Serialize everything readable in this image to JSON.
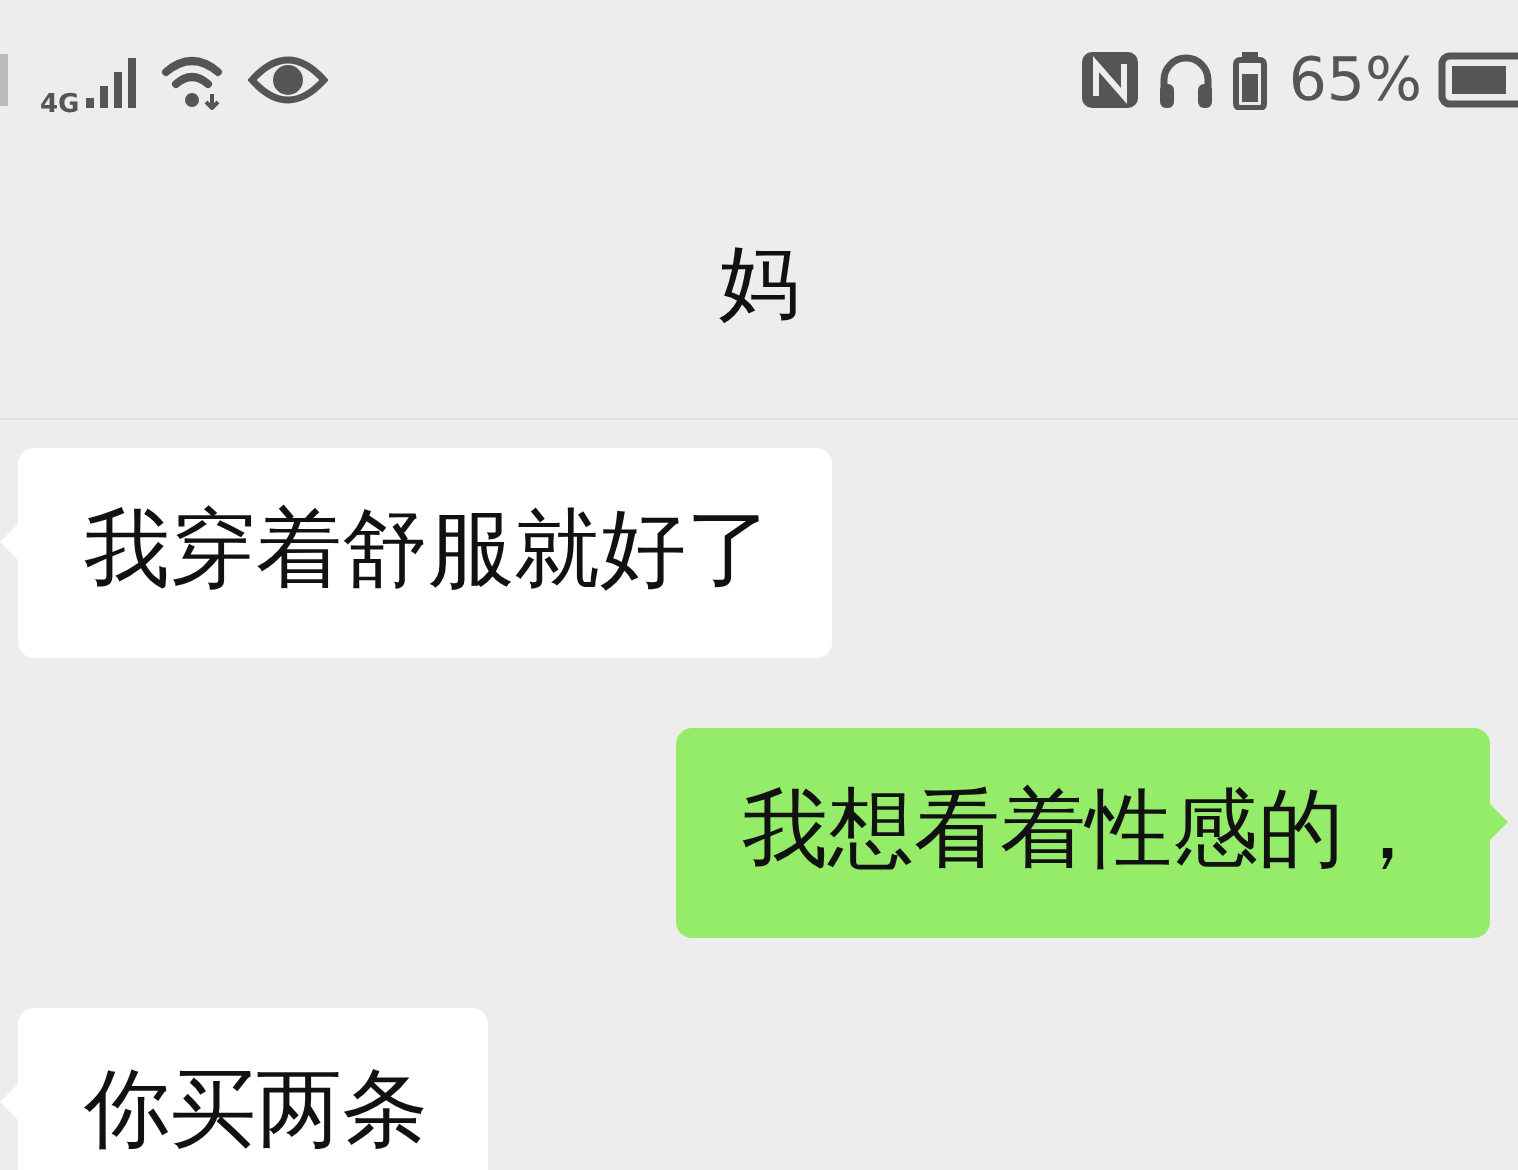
{
  "status_bar": {
    "network": "4G",
    "battery_percent": "65%"
  },
  "header": {
    "title": "妈"
  },
  "messages": [
    {
      "kind": "incoming",
      "text": "我穿着舒服就好了"
    },
    {
      "kind": "outgoing",
      "text": "我想看着性感的，"
    },
    {
      "kind": "incoming",
      "text": "你买两条"
    }
  ]
}
